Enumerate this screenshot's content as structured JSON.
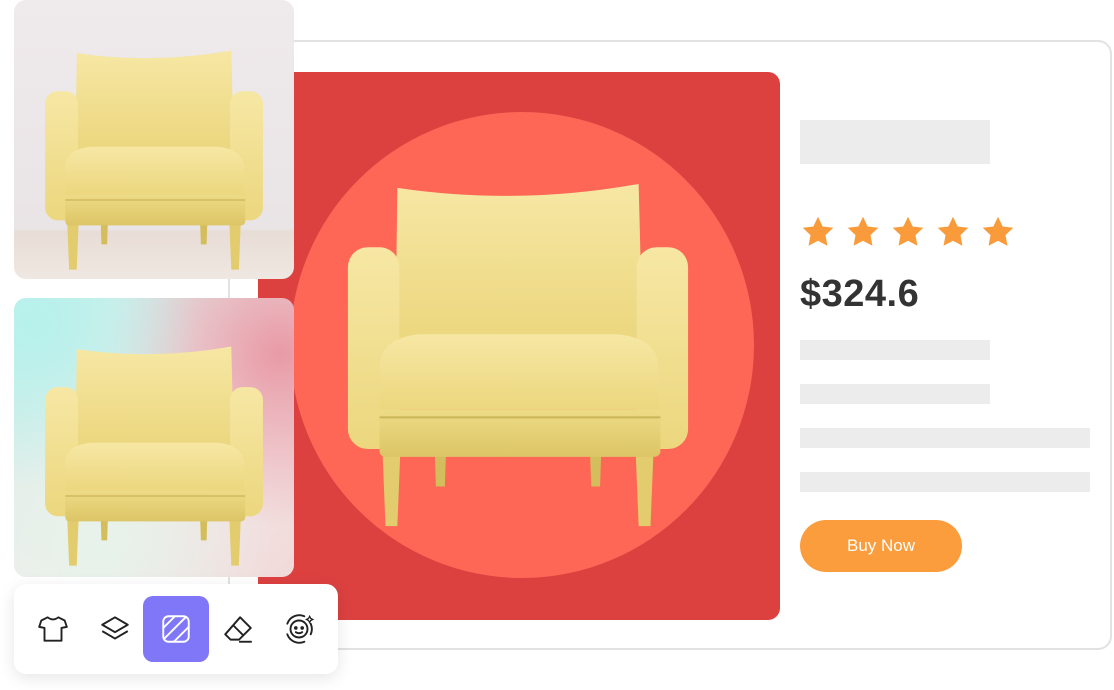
{
  "product": {
    "price": "$324.6",
    "rating_stars": 5,
    "buy_label": "Buy Now"
  },
  "colors": {
    "hero_background": "#dc4140",
    "hero_circle": "#fe6655",
    "star": "#f99b3b",
    "buy_button": "#fb9d3c",
    "active_tool": "#7f77f8"
  },
  "toolbar": {
    "tools": [
      {
        "icon": "tshirt-icon",
        "active": false
      },
      {
        "icon": "layers-icon",
        "active": false
      },
      {
        "icon": "background-pattern-icon",
        "active": true
      },
      {
        "icon": "eraser-icon",
        "active": false
      },
      {
        "icon": "face-retouch-icon",
        "active": false
      }
    ]
  }
}
